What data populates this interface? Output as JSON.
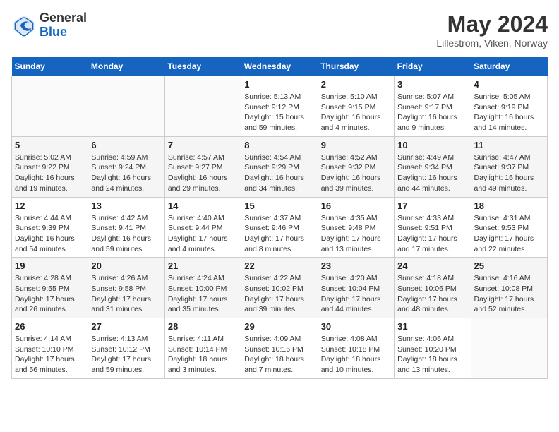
{
  "logo": {
    "general": "General",
    "blue": "Blue"
  },
  "title": {
    "month_year": "May 2024",
    "location": "Lillestrom, Viken, Norway"
  },
  "weekdays": [
    "Sunday",
    "Monday",
    "Tuesday",
    "Wednesday",
    "Thursday",
    "Friday",
    "Saturday"
  ],
  "weeks": [
    [
      {
        "day": "",
        "info": ""
      },
      {
        "day": "",
        "info": ""
      },
      {
        "day": "",
        "info": ""
      },
      {
        "day": "1",
        "info": "Sunrise: 5:13 AM\nSunset: 9:12 PM\nDaylight: 15 hours\nand 59 minutes."
      },
      {
        "day": "2",
        "info": "Sunrise: 5:10 AM\nSunset: 9:15 PM\nDaylight: 16 hours\nand 4 minutes."
      },
      {
        "day": "3",
        "info": "Sunrise: 5:07 AM\nSunset: 9:17 PM\nDaylight: 16 hours\nand 9 minutes."
      },
      {
        "day": "4",
        "info": "Sunrise: 5:05 AM\nSunset: 9:19 PM\nDaylight: 16 hours\nand 14 minutes."
      }
    ],
    [
      {
        "day": "5",
        "info": "Sunrise: 5:02 AM\nSunset: 9:22 PM\nDaylight: 16 hours\nand 19 minutes."
      },
      {
        "day": "6",
        "info": "Sunrise: 4:59 AM\nSunset: 9:24 PM\nDaylight: 16 hours\nand 24 minutes."
      },
      {
        "day": "7",
        "info": "Sunrise: 4:57 AM\nSunset: 9:27 PM\nDaylight: 16 hours\nand 29 minutes."
      },
      {
        "day": "8",
        "info": "Sunrise: 4:54 AM\nSunset: 9:29 PM\nDaylight: 16 hours\nand 34 minutes."
      },
      {
        "day": "9",
        "info": "Sunrise: 4:52 AM\nSunset: 9:32 PM\nDaylight: 16 hours\nand 39 minutes."
      },
      {
        "day": "10",
        "info": "Sunrise: 4:49 AM\nSunset: 9:34 PM\nDaylight: 16 hours\nand 44 minutes."
      },
      {
        "day": "11",
        "info": "Sunrise: 4:47 AM\nSunset: 9:37 PM\nDaylight: 16 hours\nand 49 minutes."
      }
    ],
    [
      {
        "day": "12",
        "info": "Sunrise: 4:44 AM\nSunset: 9:39 PM\nDaylight: 16 hours\nand 54 minutes."
      },
      {
        "day": "13",
        "info": "Sunrise: 4:42 AM\nSunset: 9:41 PM\nDaylight: 16 hours\nand 59 minutes."
      },
      {
        "day": "14",
        "info": "Sunrise: 4:40 AM\nSunset: 9:44 PM\nDaylight: 17 hours\nand 4 minutes."
      },
      {
        "day": "15",
        "info": "Sunrise: 4:37 AM\nSunset: 9:46 PM\nDaylight: 17 hours\nand 8 minutes."
      },
      {
        "day": "16",
        "info": "Sunrise: 4:35 AM\nSunset: 9:48 PM\nDaylight: 17 hours\nand 13 minutes."
      },
      {
        "day": "17",
        "info": "Sunrise: 4:33 AM\nSunset: 9:51 PM\nDaylight: 17 hours\nand 17 minutes."
      },
      {
        "day": "18",
        "info": "Sunrise: 4:31 AM\nSunset: 9:53 PM\nDaylight: 17 hours\nand 22 minutes."
      }
    ],
    [
      {
        "day": "19",
        "info": "Sunrise: 4:28 AM\nSunset: 9:55 PM\nDaylight: 17 hours\nand 26 minutes."
      },
      {
        "day": "20",
        "info": "Sunrise: 4:26 AM\nSunset: 9:58 PM\nDaylight: 17 hours\nand 31 minutes."
      },
      {
        "day": "21",
        "info": "Sunrise: 4:24 AM\nSunset: 10:00 PM\nDaylight: 17 hours\nand 35 minutes."
      },
      {
        "day": "22",
        "info": "Sunrise: 4:22 AM\nSunset: 10:02 PM\nDaylight: 17 hours\nand 39 minutes."
      },
      {
        "day": "23",
        "info": "Sunrise: 4:20 AM\nSunset: 10:04 PM\nDaylight: 17 hours\nand 44 minutes."
      },
      {
        "day": "24",
        "info": "Sunrise: 4:18 AM\nSunset: 10:06 PM\nDaylight: 17 hours\nand 48 minutes."
      },
      {
        "day": "25",
        "info": "Sunrise: 4:16 AM\nSunset: 10:08 PM\nDaylight: 17 hours\nand 52 minutes."
      }
    ],
    [
      {
        "day": "26",
        "info": "Sunrise: 4:14 AM\nSunset: 10:10 PM\nDaylight: 17 hours\nand 56 minutes."
      },
      {
        "day": "27",
        "info": "Sunrise: 4:13 AM\nSunset: 10:12 PM\nDaylight: 17 hours\nand 59 minutes."
      },
      {
        "day": "28",
        "info": "Sunrise: 4:11 AM\nSunset: 10:14 PM\nDaylight: 18 hours\nand 3 minutes."
      },
      {
        "day": "29",
        "info": "Sunrise: 4:09 AM\nSunset: 10:16 PM\nDaylight: 18 hours\nand 7 minutes."
      },
      {
        "day": "30",
        "info": "Sunrise: 4:08 AM\nSunset: 10:18 PM\nDaylight: 18 hours\nand 10 minutes."
      },
      {
        "day": "31",
        "info": "Sunrise: 4:06 AM\nSunset: 10:20 PM\nDaylight: 18 hours\nand 13 minutes."
      },
      {
        "day": "",
        "info": ""
      }
    ]
  ]
}
